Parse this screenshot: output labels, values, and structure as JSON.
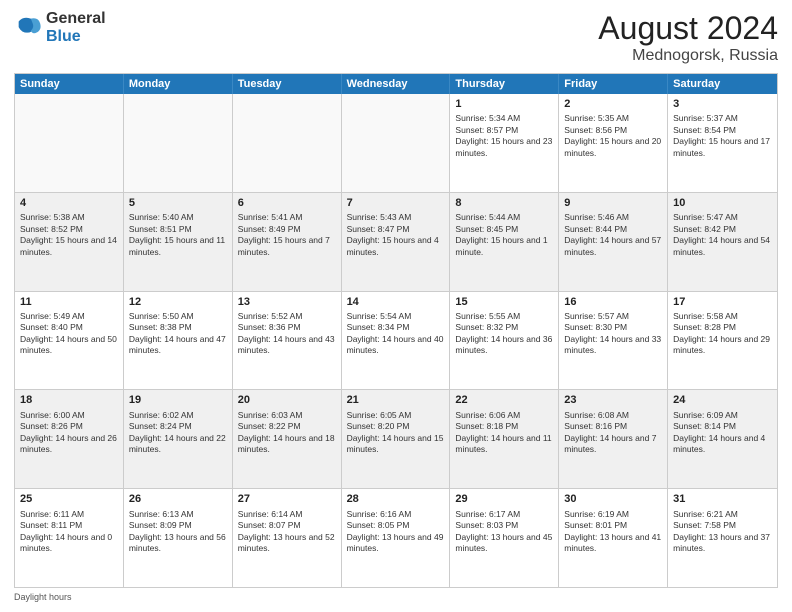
{
  "logo": {
    "general": "General",
    "blue": "Blue"
  },
  "title": {
    "month_year": "August 2024",
    "location": "Mednogorsk, Russia"
  },
  "days_of_week": [
    "Sunday",
    "Monday",
    "Tuesday",
    "Wednesday",
    "Thursday",
    "Friday",
    "Saturday"
  ],
  "footer": {
    "note": "Daylight hours"
  },
  "weeks": [
    [
      {
        "day": "",
        "empty": true
      },
      {
        "day": "",
        "empty": true
      },
      {
        "day": "",
        "empty": true
      },
      {
        "day": "",
        "empty": true
      },
      {
        "day": "1",
        "sunrise": "Sunrise: 5:34 AM",
        "sunset": "Sunset: 8:57 PM",
        "daylight": "Daylight: 15 hours and 23 minutes."
      },
      {
        "day": "2",
        "sunrise": "Sunrise: 5:35 AM",
        "sunset": "Sunset: 8:56 PM",
        "daylight": "Daylight: 15 hours and 20 minutes."
      },
      {
        "day": "3",
        "sunrise": "Sunrise: 5:37 AM",
        "sunset": "Sunset: 8:54 PM",
        "daylight": "Daylight: 15 hours and 17 minutes."
      }
    ],
    [
      {
        "day": "4",
        "sunrise": "Sunrise: 5:38 AM",
        "sunset": "Sunset: 8:52 PM",
        "daylight": "Daylight: 15 hours and 14 minutes."
      },
      {
        "day": "5",
        "sunrise": "Sunrise: 5:40 AM",
        "sunset": "Sunset: 8:51 PM",
        "daylight": "Daylight: 15 hours and 11 minutes."
      },
      {
        "day": "6",
        "sunrise": "Sunrise: 5:41 AM",
        "sunset": "Sunset: 8:49 PM",
        "daylight": "Daylight: 15 hours and 7 minutes."
      },
      {
        "day": "7",
        "sunrise": "Sunrise: 5:43 AM",
        "sunset": "Sunset: 8:47 PM",
        "daylight": "Daylight: 15 hours and 4 minutes."
      },
      {
        "day": "8",
        "sunrise": "Sunrise: 5:44 AM",
        "sunset": "Sunset: 8:45 PM",
        "daylight": "Daylight: 15 hours and 1 minute."
      },
      {
        "day": "9",
        "sunrise": "Sunrise: 5:46 AM",
        "sunset": "Sunset: 8:44 PM",
        "daylight": "Daylight: 14 hours and 57 minutes."
      },
      {
        "day": "10",
        "sunrise": "Sunrise: 5:47 AM",
        "sunset": "Sunset: 8:42 PM",
        "daylight": "Daylight: 14 hours and 54 minutes."
      }
    ],
    [
      {
        "day": "11",
        "sunrise": "Sunrise: 5:49 AM",
        "sunset": "Sunset: 8:40 PM",
        "daylight": "Daylight: 14 hours and 50 minutes."
      },
      {
        "day": "12",
        "sunrise": "Sunrise: 5:50 AM",
        "sunset": "Sunset: 8:38 PM",
        "daylight": "Daylight: 14 hours and 47 minutes."
      },
      {
        "day": "13",
        "sunrise": "Sunrise: 5:52 AM",
        "sunset": "Sunset: 8:36 PM",
        "daylight": "Daylight: 14 hours and 43 minutes."
      },
      {
        "day": "14",
        "sunrise": "Sunrise: 5:54 AM",
        "sunset": "Sunset: 8:34 PM",
        "daylight": "Daylight: 14 hours and 40 minutes."
      },
      {
        "day": "15",
        "sunrise": "Sunrise: 5:55 AM",
        "sunset": "Sunset: 8:32 PM",
        "daylight": "Daylight: 14 hours and 36 minutes."
      },
      {
        "day": "16",
        "sunrise": "Sunrise: 5:57 AM",
        "sunset": "Sunset: 8:30 PM",
        "daylight": "Daylight: 14 hours and 33 minutes."
      },
      {
        "day": "17",
        "sunrise": "Sunrise: 5:58 AM",
        "sunset": "Sunset: 8:28 PM",
        "daylight": "Daylight: 14 hours and 29 minutes."
      }
    ],
    [
      {
        "day": "18",
        "sunrise": "Sunrise: 6:00 AM",
        "sunset": "Sunset: 8:26 PM",
        "daylight": "Daylight: 14 hours and 26 minutes."
      },
      {
        "day": "19",
        "sunrise": "Sunrise: 6:02 AM",
        "sunset": "Sunset: 8:24 PM",
        "daylight": "Daylight: 14 hours and 22 minutes."
      },
      {
        "day": "20",
        "sunrise": "Sunrise: 6:03 AM",
        "sunset": "Sunset: 8:22 PM",
        "daylight": "Daylight: 14 hours and 18 minutes."
      },
      {
        "day": "21",
        "sunrise": "Sunrise: 6:05 AM",
        "sunset": "Sunset: 8:20 PM",
        "daylight": "Daylight: 14 hours and 15 minutes."
      },
      {
        "day": "22",
        "sunrise": "Sunrise: 6:06 AM",
        "sunset": "Sunset: 8:18 PM",
        "daylight": "Daylight: 14 hours and 11 minutes."
      },
      {
        "day": "23",
        "sunrise": "Sunrise: 6:08 AM",
        "sunset": "Sunset: 8:16 PM",
        "daylight": "Daylight: 14 hours and 7 minutes."
      },
      {
        "day": "24",
        "sunrise": "Sunrise: 6:09 AM",
        "sunset": "Sunset: 8:14 PM",
        "daylight": "Daylight: 14 hours and 4 minutes."
      }
    ],
    [
      {
        "day": "25",
        "sunrise": "Sunrise: 6:11 AM",
        "sunset": "Sunset: 8:11 PM",
        "daylight": "Daylight: 14 hours and 0 minutes."
      },
      {
        "day": "26",
        "sunrise": "Sunrise: 6:13 AM",
        "sunset": "Sunset: 8:09 PM",
        "daylight": "Daylight: 13 hours and 56 minutes."
      },
      {
        "day": "27",
        "sunrise": "Sunrise: 6:14 AM",
        "sunset": "Sunset: 8:07 PM",
        "daylight": "Daylight: 13 hours and 52 minutes."
      },
      {
        "day": "28",
        "sunrise": "Sunrise: 6:16 AM",
        "sunset": "Sunset: 8:05 PM",
        "daylight": "Daylight: 13 hours and 49 minutes."
      },
      {
        "day": "29",
        "sunrise": "Sunrise: 6:17 AM",
        "sunset": "Sunset: 8:03 PM",
        "daylight": "Daylight: 13 hours and 45 minutes."
      },
      {
        "day": "30",
        "sunrise": "Sunrise: 6:19 AM",
        "sunset": "Sunset: 8:01 PM",
        "daylight": "Daylight: 13 hours and 41 minutes."
      },
      {
        "day": "31",
        "sunrise": "Sunrise: 6:21 AM",
        "sunset": "Sunset: 7:58 PM",
        "daylight": "Daylight: 13 hours and 37 minutes."
      }
    ]
  ]
}
